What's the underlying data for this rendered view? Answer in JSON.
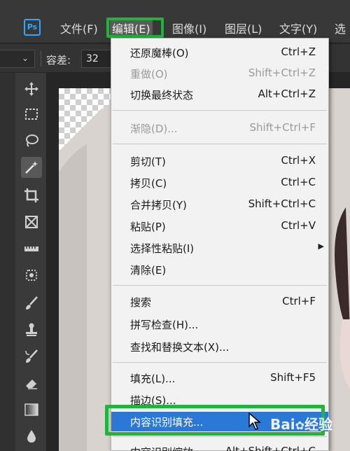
{
  "app": {
    "logo_text": "Ps"
  },
  "menubar": {
    "items": [
      {
        "label": "文件(F)"
      },
      {
        "label": "编辑(E)"
      },
      {
        "label": "图像(I)"
      },
      {
        "label": "图层(L)"
      },
      {
        "label": "文字(Y)"
      },
      {
        "label": "选"
      }
    ]
  },
  "options": {
    "tolerance_label": "容差:",
    "tolerance_value": "32"
  },
  "edit_menu": {
    "items": [
      {
        "label": "还原魔棒(O)",
        "shortcut": "Ctrl+Z"
      },
      {
        "label": "重做(O)",
        "shortcut": "Shift+Ctrl+Z"
      },
      {
        "label": "切换最终状态",
        "shortcut": "Alt+Ctrl+Z"
      },
      {
        "label": "渐隐(D)...",
        "shortcut": "Shift+Ctrl+F"
      },
      {
        "label": "剪切(T)",
        "shortcut": "Ctrl+X"
      },
      {
        "label": "拷贝(C)",
        "shortcut": "Ctrl+C"
      },
      {
        "label": "合并拷贝(Y)",
        "shortcut": "Shift+Ctrl+C"
      },
      {
        "label": "粘贴(P)",
        "shortcut": "Ctrl+V"
      },
      {
        "label": "选择性粘贴(I)",
        "shortcut": ""
      },
      {
        "label": "清除(E)",
        "shortcut": ""
      },
      {
        "label": "搜索",
        "shortcut": "Ctrl+F"
      },
      {
        "label": "拼写检查(H)...",
        "shortcut": ""
      },
      {
        "label": "查找和替换文本(X)...",
        "shortcut": ""
      },
      {
        "label": "填充(L)...",
        "shortcut": "Shift+F5"
      },
      {
        "label": "描边(S)...",
        "shortcut": ""
      },
      {
        "label": "内容识别填充...",
        "shortcut": ""
      },
      {
        "label": "内容识别缩放",
        "shortcut": "Alt+Shift+Ctrl+C"
      }
    ]
  },
  "watermark": {
    "text": "Bai",
    "suffix": "经验"
  },
  "colors": {
    "highlight_green": "#1fb43a",
    "menu_selection": "#2a78d8"
  }
}
